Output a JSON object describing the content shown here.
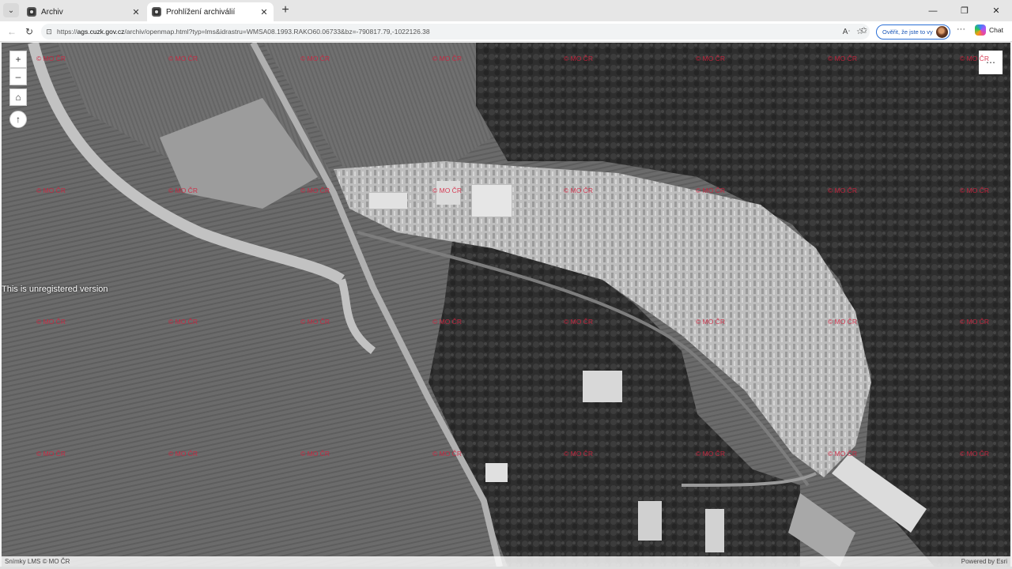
{
  "browser": {
    "tabs": [
      {
        "title": "Archiv",
        "active": false,
        "close": "✕"
      },
      {
        "title": "Prohlížení archiválií",
        "active": true,
        "close": "✕"
      }
    ],
    "tab_menu_icon": "chevron-down-icon",
    "new_tab_label": "+",
    "window_buttons": {
      "minimize": "—",
      "restore": "❐",
      "close": "✕"
    },
    "url": {
      "protocol": "https://",
      "host": "ags.cuzk.gov.cz",
      "path": "/archiv/openmap.html?typ=lms&idrastru=WMSA08.1993.RAKO60.06733&bz=-790817.79,-1022126.38"
    },
    "verify_button": "Ověřit, že jste to vy",
    "chat_button": "Chat"
  },
  "map": {
    "controls": {
      "zoom_in": "+",
      "zoom_out": "–",
      "home": "⌂",
      "compass": "↑",
      "menu": "⋯"
    },
    "watermark_text": "© MO ČR",
    "unregistered_text": "This is unregistered version",
    "attribution_left": "Snímky LMS © MO ČR",
    "attribution_right": "Powered by Esri",
    "colors": {
      "watermark": "#d4213d",
      "field": "#6a6a6a",
      "forest": "#2a2a2a",
      "road": "#b5b5b5"
    }
  }
}
